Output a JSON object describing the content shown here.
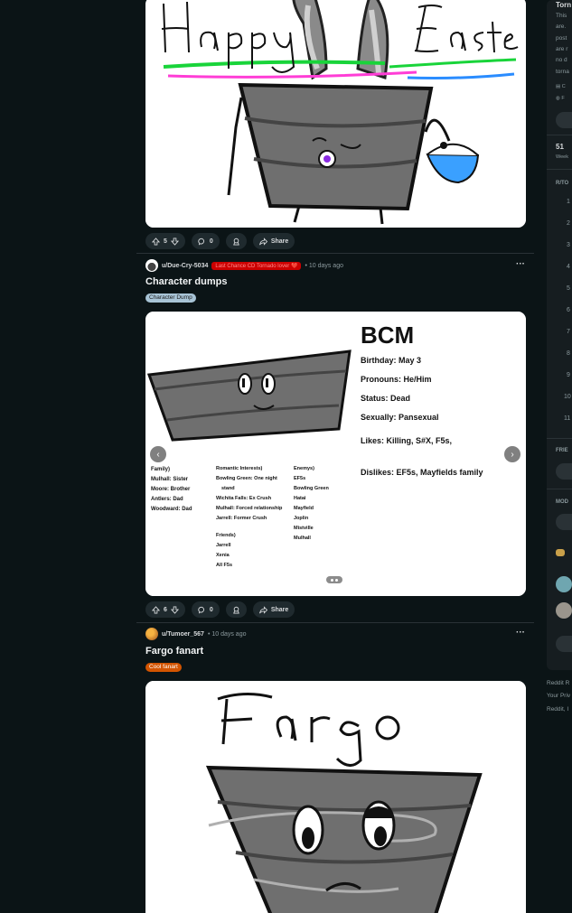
{
  "posts": [
    {
      "votes": "5",
      "comments": "0",
      "share_label": "Share",
      "image_text": "Happy Easter"
    },
    {
      "username": "u/Due-Cry-5034",
      "user_flair": "Last Chance CD Tornado lover ❤️",
      "time": "• 10 days ago",
      "title": "Character dumps",
      "flair": "Character Dump",
      "votes": "6",
      "comments": "0",
      "share_label": "Share",
      "image": {
        "name": "BCM",
        "birthday": "Birthday: May 3",
        "pronouns": "Pronouns: He/Him",
        "status": "Status: Dead",
        "sexuality": "Sexually: Pansexual",
        "likes": "Likes: Killing, S#X, F5s,",
        "dislikes": "Dislikes: EF5s, Mayfields family",
        "family": [
          "Family)",
          "Mulhall: Sister",
          "Moore: Brother",
          "Antlers: Dad",
          "Woodward: Dad"
        ],
        "romantic": [
          "Romantic Interests)",
          "Bowling Green: One night",
          "stand",
          "Wichita Falls: Ex Crush",
          "Mulhall: Forced relationship",
          "Jarrell: Former Crush",
          "",
          "Friends)",
          "Jarrell",
          "Xenia",
          "All F5s"
        ],
        "enemies": [
          "Enemys)",
          "EF5s",
          "Bowling Green",
          "Hatai",
          "Mayfield",
          "Joplin",
          "Mistville",
          "Mulhall"
        ]
      }
    },
    {
      "username": "u/Tumoer_567",
      "time": "• 10 days ago",
      "title": "Fargo fanart",
      "flair": "Cool fanart",
      "image_text": "Fargo"
    }
  ],
  "sidebar": {
    "top_title": "Torn",
    "description": [
      "This",
      "are.",
      "post",
      "are r",
      "no d",
      "torna"
    ],
    "info1": "C",
    "info2": "F",
    "stat_value": "51",
    "stat_label": "Week",
    "rank_header": "R/TO",
    "ranks": [
      "1",
      "2",
      "3",
      "4",
      "5",
      "6",
      "7",
      "8",
      "9",
      "10",
      "11"
    ],
    "friends_header": "FRIE",
    "mods_header": "MOD"
  },
  "footer": [
    "Reddit R",
    "Your Priv",
    "Reddit, I"
  ],
  "colors": {
    "background": "#0b1416",
    "sidebar": "#161d20",
    "user_flair": "#cc0000",
    "character_dump_flair": "#a8c4d6",
    "fanart_flair": "#d35400"
  }
}
